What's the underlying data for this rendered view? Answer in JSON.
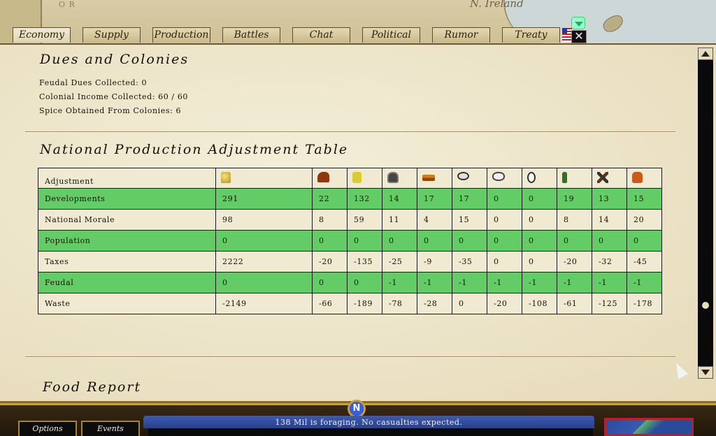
{
  "map": {
    "region_label": "N. Ireland",
    "left_label": "O R"
  },
  "tabs": [
    {
      "label": "Economy",
      "active": true
    },
    {
      "label": "Supply"
    },
    {
      "label": "Production"
    },
    {
      "label": "Battles"
    },
    {
      "label": "Chat"
    },
    {
      "label": "Political"
    },
    {
      "label": "Rumor"
    },
    {
      "label": "Treaty"
    }
  ],
  "close_glyph": "✕",
  "dues": {
    "heading": "Dues and Colonies",
    "feudal_dues": "Feudal Dues Collected:  0",
    "colonial_income": "Colonial Income Collected:  60 / 60",
    "spice_obtained": "Spice Obtained From Colonies:  6"
  },
  "adjustment_table": {
    "heading": "National Production Adjustment Table",
    "column_header": "Adjustment",
    "resource_icons": [
      "gold-icon",
      "horse-icon",
      "cloth-icon",
      "iron-icon",
      "timber-icon",
      "wool-icon",
      "cotton-icon",
      "spice-icon",
      "wine-icon",
      "arms-icon",
      "leather-icon"
    ],
    "rows": [
      {
        "label": "Developments",
        "values": [
          "291",
          "22",
          "132",
          "14",
          "17",
          "17",
          "0",
          "0",
          "19",
          "13",
          "15"
        ]
      },
      {
        "label": "National Morale",
        "values": [
          "98",
          "8",
          "59",
          "11",
          "4",
          "15",
          "0",
          "0",
          "8",
          "14",
          "20"
        ]
      },
      {
        "label": "Population",
        "values": [
          "0",
          "0",
          "0",
          "0",
          "0",
          "0",
          "0",
          "0",
          "0",
          "0",
          "0"
        ]
      },
      {
        "label": "Taxes",
        "values": [
          "2222",
          "-20",
          "-135",
          "-25",
          "-9",
          "-35",
          "0",
          "0",
          "-20",
          "-32",
          "-45"
        ]
      },
      {
        "label": "Feudal",
        "values": [
          "0",
          "0",
          "0",
          "-1",
          "-1",
          "-1",
          "-1",
          "-1",
          "-1",
          "-1",
          "-1"
        ]
      },
      {
        "label": "Waste",
        "values": [
          "-2149",
          "-66",
          "-189",
          "-78",
          "-28",
          "0",
          "-20",
          "-108",
          "-61",
          "-125",
          "-178"
        ]
      }
    ]
  },
  "food": {
    "heading": "Food Report"
  },
  "bottom_bar": {
    "options_label": "Options",
    "events_label": "Events",
    "compass_letter": "N",
    "message": "138 Mil is foraging.  No casualties expected."
  }
}
